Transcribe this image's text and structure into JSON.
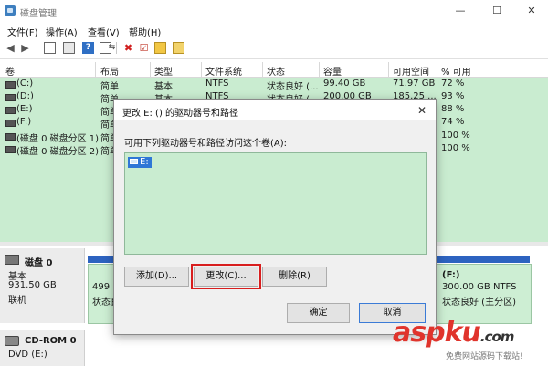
{
  "window": {
    "title": "磁盘管理",
    "controls": [
      "—",
      "☐",
      "✕"
    ]
  },
  "menu": [
    "文件(F)",
    "操作(A)",
    "查看(V)",
    "帮助(H)"
  ],
  "toolbar": {
    "icons": [
      "back-icon",
      "forward-icon",
      "console-tree-icon",
      "properties-icon",
      "help-icon",
      "show-icon",
      "connect-icon",
      "delete-icon",
      "check-icon",
      "new-file-icon",
      "new-folder-icon"
    ]
  },
  "columns": [
    "卷",
    "布局",
    "类型",
    "文件系统",
    "状态",
    "容量",
    "可用空间",
    "% 可用"
  ],
  "volumes": [
    {
      "name": "(C:)",
      "layout": "简单",
      "type": "基本",
      "fs": "NTFS",
      "status": "状态良好 (...",
      "capacity": "99.40 GB",
      "free": "71.97 GB",
      "pct": "72 %"
    },
    {
      "name": "(D:)",
      "layout": "简单",
      "type": "基本",
      "fs": "NTFS",
      "status": "状态良好 (...",
      "capacity": "200.00 GB",
      "free": "185.25 ...",
      "pct": "93 %"
    },
    {
      "name": "(E:)",
      "layout": "简单",
      "type": "",
      "fs": "",
      "status": "",
      "capacity": "",
      "free": "",
      "pct": "88 %"
    },
    {
      "name": "(F:)",
      "layout": "简单",
      "type": "",
      "fs": "",
      "status": "",
      "capacity": "",
      "free": "",
      "pct": "74 %"
    },
    {
      "name": "(磁盘 0 磁盘分区 1)",
      "layout": "简单",
      "type": "",
      "fs": "",
      "status": "",
      "capacity": "",
      "free": "",
      "pct": "100 %"
    },
    {
      "name": "(磁盘 0 磁盘分区 2)",
      "layout": "简单",
      "type": "",
      "fs": "",
      "status": "",
      "capacity": "",
      "free": "",
      "pct": "100 %"
    }
  ],
  "disks": [
    {
      "name": "磁盘 0",
      "kind": "基本",
      "size": "931.50 GB",
      "state": "联机"
    },
    {
      "name": "CD-ROM 0",
      "kind": "DVD (E:)",
      "size": "",
      "state": ""
    }
  ],
  "partitions": {
    "left_size": "499",
    "left_status": "状态良",
    "right_name": "(F:)",
    "right_size": "300.00 GB NTFS",
    "right_status": "状态良好 (主分区)"
  },
  "dialog": {
    "title": "更改 E: () 的驱动器号和路径",
    "close": "✕",
    "instruction": "可用下列驱动器号和路径访问这个卷(A):",
    "list_item": "E:",
    "add": "添加(D)...",
    "change": "更改(C)...",
    "remove": "删除(R)",
    "ok": "确定",
    "cancel": "取消"
  },
  "watermark": {
    "brand": "aspku",
    "tld": ".com",
    "slogan": "免费网站源码下载站!"
  },
  "colors": {
    "volume_bg": "#c9ecd0",
    "selection": "#2f77d6",
    "disk_strip": "#2d63c0",
    "highlight_outline": "#d81e1e",
    "watermark": "#e0342c"
  }
}
